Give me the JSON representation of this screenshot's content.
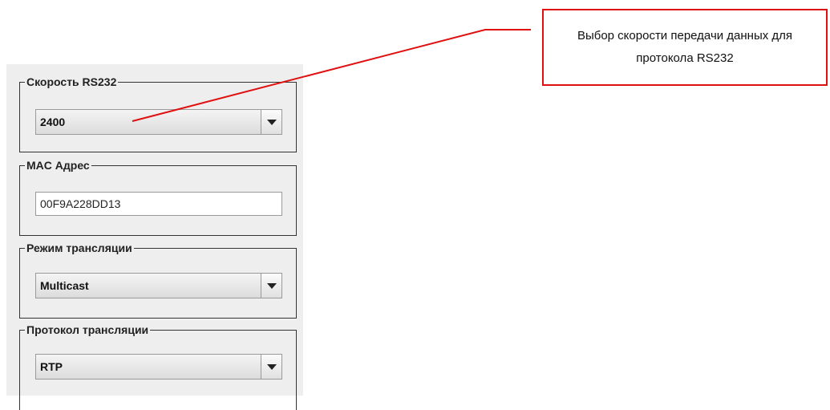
{
  "groups": {
    "baud": {
      "title": "Скорость RS232",
      "value": "2400"
    },
    "mac": {
      "title": "MAC Адрес",
      "value": "00F9A228DD13"
    },
    "mode": {
      "title": "Режим трансляции",
      "value": "Multicast"
    },
    "protocol": {
      "title": "Протокол трансляции",
      "value": "RTP"
    }
  },
  "annotation": {
    "text": "Выбор скорости передачи данных для протокола RS232",
    "color": "#e01010"
  }
}
